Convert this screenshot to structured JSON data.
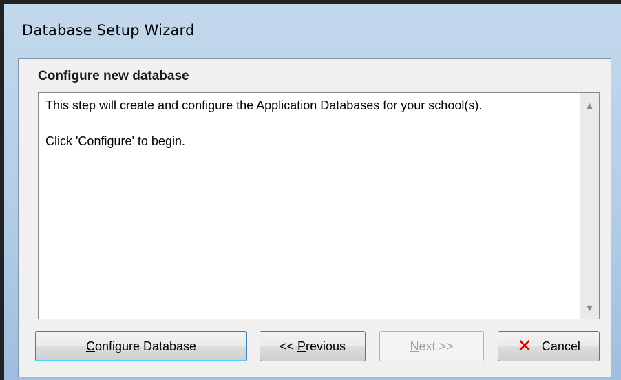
{
  "window": {
    "title": "Database Setup Wizard"
  },
  "section": {
    "title": "Configure new database"
  },
  "message": {
    "paragraph1": "This step will create and configure the Application Databases for your school(s).",
    "paragraph2": "Click 'Configure' to begin."
  },
  "buttons": {
    "configure": {
      "accel": "C",
      "rest": "onfigure Database",
      "enabled": true,
      "default": true
    },
    "previous": {
      "prefix": "<< ",
      "accel": "P",
      "rest": "revious",
      "enabled": true
    },
    "next": {
      "accel": "N",
      "rest": "ext >>",
      "enabled": false
    },
    "cancel": {
      "label": "Cancel",
      "icon": "close-x-icon",
      "icon_color": "#d40000",
      "enabled": true
    }
  }
}
